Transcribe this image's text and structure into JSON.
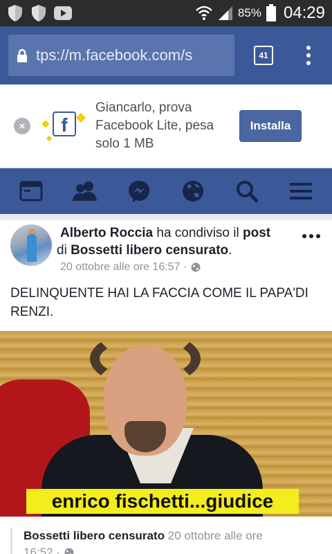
{
  "status": {
    "battery": "85%",
    "time": "04:29",
    "icons": [
      "shield-icon",
      "shield-icon",
      "youtube-icon",
      "wifi-icon",
      "signal-icon",
      "battery-icon"
    ]
  },
  "browser": {
    "url": "tps://m.facebook.com/s",
    "tab_count": "41",
    "accent": "#3b5998"
  },
  "banner": {
    "text": "Giancarlo, prova Facebook Lite, pesa solo 1 MB",
    "install_label": "Installa",
    "logo_letter": "f"
  },
  "nav": {
    "icons": [
      "news-feed-icon",
      "friends-icon",
      "messenger-icon",
      "globe-icon",
      "search-icon",
      "menu-icon"
    ]
  },
  "post": {
    "author": "Alberto Roccia",
    "shared_text": " ha condiviso il ",
    "post_word": "post",
    "di_text": " di ",
    "page_name": "Bossetti libero censurato",
    "period": ".",
    "date": "20 ottobre alle ore 16:57 ·",
    "body": "DELINQUENTE HAI LA FACCIA COME IL PAPA'DI RENZI.",
    "image_caption": "enrico fischetti...giudice",
    "shared_from": {
      "page_name": "Bossetti libero censurato",
      "date_part1": " 20 ottobre alle ore",
      "date_part2": "16:52 ·"
    }
  }
}
